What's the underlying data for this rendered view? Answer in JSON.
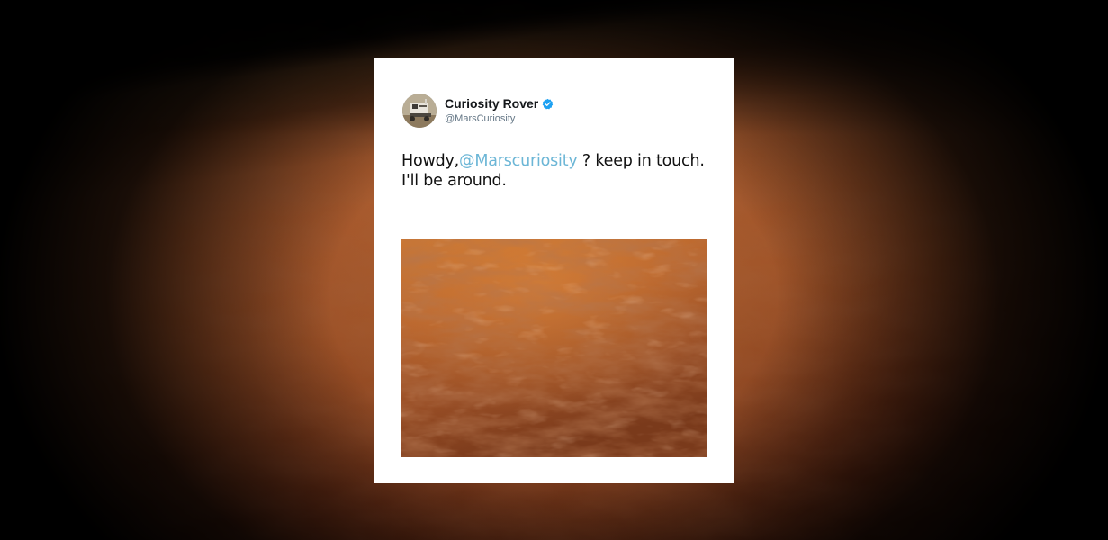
{
  "tweet": {
    "author": {
      "display_name": "Curiosity Rover",
      "handle": "@MarsCuriosity",
      "verified": true,
      "avatar_icon": "rover-avatar",
      "verified_icon": "verified-badge-icon"
    },
    "text_before": "Howdy,",
    "mention": "@Marscuriosity",
    "text_after": " ? keep in touch. I'll be around.",
    "media": {
      "type": "image",
      "subject": "mars-surface"
    }
  },
  "colors": {
    "mention": "#6cb6d6",
    "verified_badge": "#1da1f2",
    "card_bg": "#ffffff",
    "page_bg": "#000000"
  }
}
